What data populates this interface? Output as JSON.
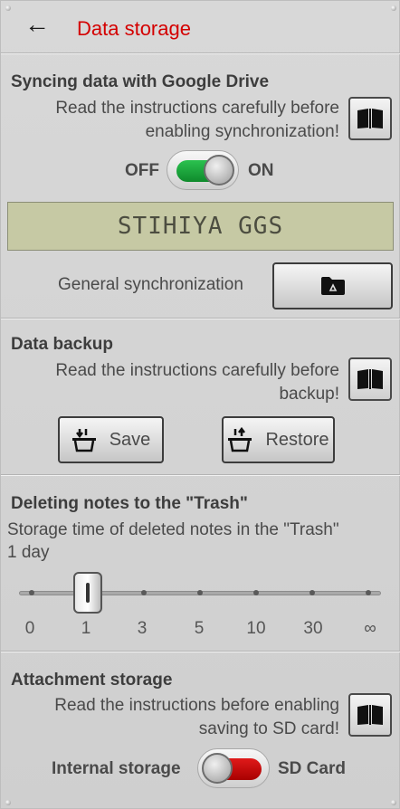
{
  "header": {
    "back_icon": "arrow-left",
    "title": "Data storage"
  },
  "google_sync": {
    "heading": "Syncing data with Google Drive",
    "desc_line1": "Read the instructions carefully before",
    "desc_line2": "enabling synchronization!",
    "toggle_off": "OFF",
    "toggle_on": "ON",
    "toggle_state": "on",
    "account_display": "STIHIYA GGS",
    "general_sync_label": "General synchronization",
    "drive_icon": "google-drive-folder-icon"
  },
  "backup": {
    "heading": "Data backup",
    "desc_line1": "Read the instructions carefully before",
    "desc_line2": "backup!",
    "save_label": "Save",
    "restore_label": "Restore"
  },
  "trash": {
    "heading": "Deleting notes to the \"Trash\"",
    "desc": "Storage time of deleted notes in the \"Trash\"",
    "value_text": "1 day",
    "ticks": [
      "0",
      "1",
      "3",
      "5",
      "10",
      "30",
      "∞"
    ],
    "selected_index": 1
  },
  "attachments": {
    "heading": "Attachment storage",
    "desc_line1": "Read the instructions before enabling",
    "desc_line2": "saving to SD card!",
    "left_label": "Internal storage",
    "right_label": "SD Card",
    "toggle_state": "internal"
  },
  "colors": {
    "title": "#d40000",
    "toggle_on": "#1aa13a",
    "toggle_off": "#c80000",
    "lcd": "#c6c9a4"
  }
}
